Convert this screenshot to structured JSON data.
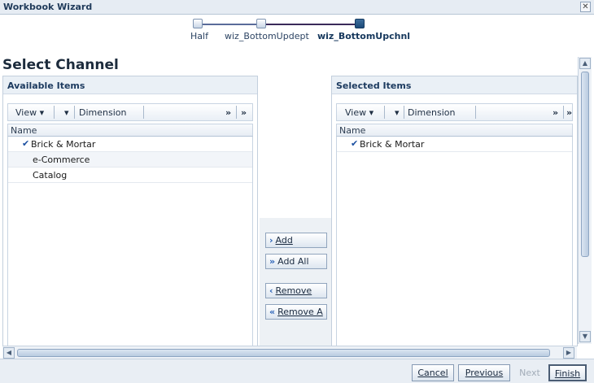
{
  "window": {
    "title": "Workbook Wizard",
    "close_glyph": "✕"
  },
  "train": {
    "stops": [
      {
        "label": "Half",
        "state": "visited"
      },
      {
        "label": "wiz_BottomUpdept",
        "state": "visited"
      },
      {
        "label": "wiz_BottomUpchnl",
        "state": "current"
      }
    ]
  },
  "page": {
    "title": "Select Channel"
  },
  "available": {
    "header": "Available Items",
    "toolbar": {
      "view_label": "View ▾",
      "menu_glyph": "▾",
      "dimension_label": "Dimension",
      "overflow_glyph": "»"
    },
    "column_name": "Name",
    "rows": [
      {
        "label": "Brick & Mortar",
        "checked": true
      },
      {
        "label": "e-Commerce",
        "checked": false
      },
      {
        "label": "Catalog",
        "checked": false
      }
    ]
  },
  "selected": {
    "header": "Selected Items",
    "toolbar": {
      "view_label": "View ▾",
      "menu_glyph": "▾",
      "dimension_label": "Dimension",
      "overflow_glyph": "»"
    },
    "column_name": "Name",
    "rows": [
      {
        "label": "Brick & Mortar",
        "checked": true
      }
    ]
  },
  "shuttle": {
    "add": "Add",
    "add_all": "Add All",
    "remove": "Remove",
    "remove_all": "Remove A"
  },
  "footer": {
    "cancel": "Cancel",
    "previous": "Previous",
    "next": "Next",
    "finish": "Finish"
  },
  "icons": {
    "check": "✔",
    "scroll_up": "▲",
    "scroll_down": "▼",
    "scroll_left": "◀",
    "scroll_right": "▶",
    "arrow_right": "›",
    "arrow_right_double": "»",
    "arrow_left": "‹",
    "arrow_left_double": "«"
  },
  "colors": {
    "accent": "#1b4a78",
    "check": "#1a4fa0",
    "header_bg": "#eaf0f6"
  }
}
